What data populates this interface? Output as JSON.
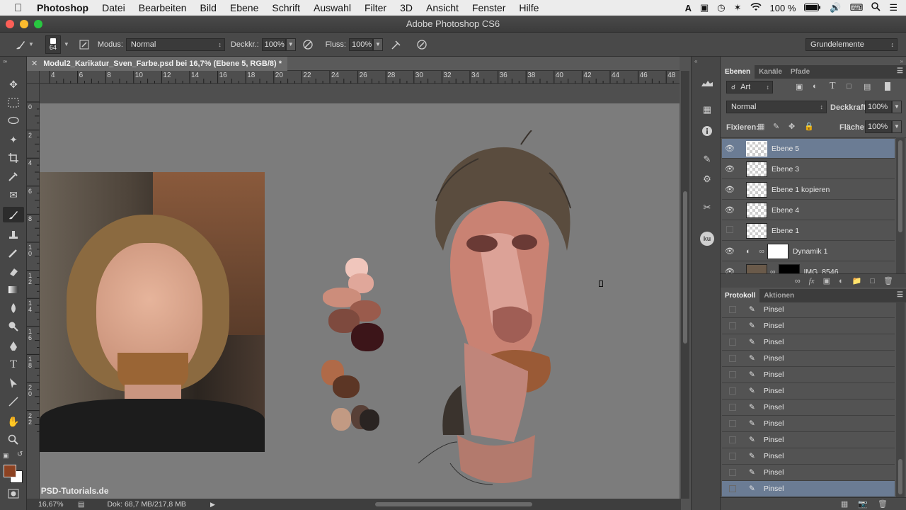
{
  "menubar": {
    "app": "Photoshop",
    "items": [
      "Datei",
      "Bearbeiten",
      "Bild",
      "Ebene",
      "Schrift",
      "Auswahl",
      "Filter",
      "3D",
      "Ansicht",
      "Fenster",
      "Hilfe"
    ],
    "battery": "100 %"
  },
  "window": {
    "title": "Adobe Photoshop CS6"
  },
  "options": {
    "brush_size": "64",
    "mode_label": "Modus:",
    "mode_value": "Normal",
    "opacity_label": "Deckkr.:",
    "opacity_value": "100%",
    "flow_label": "Fluss:",
    "flow_value": "100%",
    "workspace": "Grundelemente"
  },
  "document": {
    "tab_title": "Modul2_Karikatur_Sven_Farbe.psd bei 16,7% (Ebene 5, RGB/8) *",
    "ruler_top_labels": [
      "4",
      "6",
      "8",
      "10",
      "12",
      "14",
      "16",
      "18",
      "20",
      "22",
      "24",
      "26",
      "28",
      "30",
      "32",
      "34",
      "36",
      "38",
      "40",
      "42",
      "44",
      "46",
      "48"
    ],
    "ruler_left_labels": [
      "0",
      "2",
      "4",
      "6",
      "8",
      "1\n0",
      "1\n2",
      "1\n4",
      "1\n6",
      "1\n8",
      "2\n0",
      "2\n2"
    ],
    "watermark": "PSD-Tutorials.de"
  },
  "status": {
    "zoom": "16,67%",
    "doc_info": "Dok: 68,7 MB/217,8 MB"
  },
  "layers_panel": {
    "tabs": [
      "Ebenen",
      "Kanäle",
      "Pfade"
    ],
    "filter_kind": "Art",
    "blend_mode": "Normal",
    "opacity_label": "Deckkraft:",
    "opacity_value": "100%",
    "lock_label": "Fixieren:",
    "fill_label": "Fläche:",
    "fill_value": "100%",
    "layers": [
      {
        "name": "Ebene 5",
        "visible": true,
        "selected": true
      },
      {
        "name": "Ebene 3",
        "visible": true,
        "selected": false
      },
      {
        "name": "Ebene 1 kopieren",
        "visible": true,
        "selected": false
      },
      {
        "name": "Ebene 4",
        "visible": true,
        "selected": false
      },
      {
        "name": "Ebene 1",
        "visible": false,
        "selected": false
      },
      {
        "name": "Dynamik 1",
        "visible": true,
        "selected": false
      },
      {
        "name": "IMG_8546",
        "visible": true,
        "selected": false
      }
    ]
  },
  "history_panel": {
    "tabs": [
      "Protokoll",
      "Aktionen"
    ],
    "items": [
      "Pinsel",
      "Pinsel",
      "Pinsel",
      "Pinsel",
      "Pinsel",
      "Pinsel",
      "Pinsel",
      "Pinsel",
      "Pinsel",
      "Pinsel",
      "Pinsel",
      "Pinsel"
    ]
  },
  "colors": {
    "foreground": "#8c4222",
    "background": "#ffffff",
    "selection": "#6b7c94"
  }
}
